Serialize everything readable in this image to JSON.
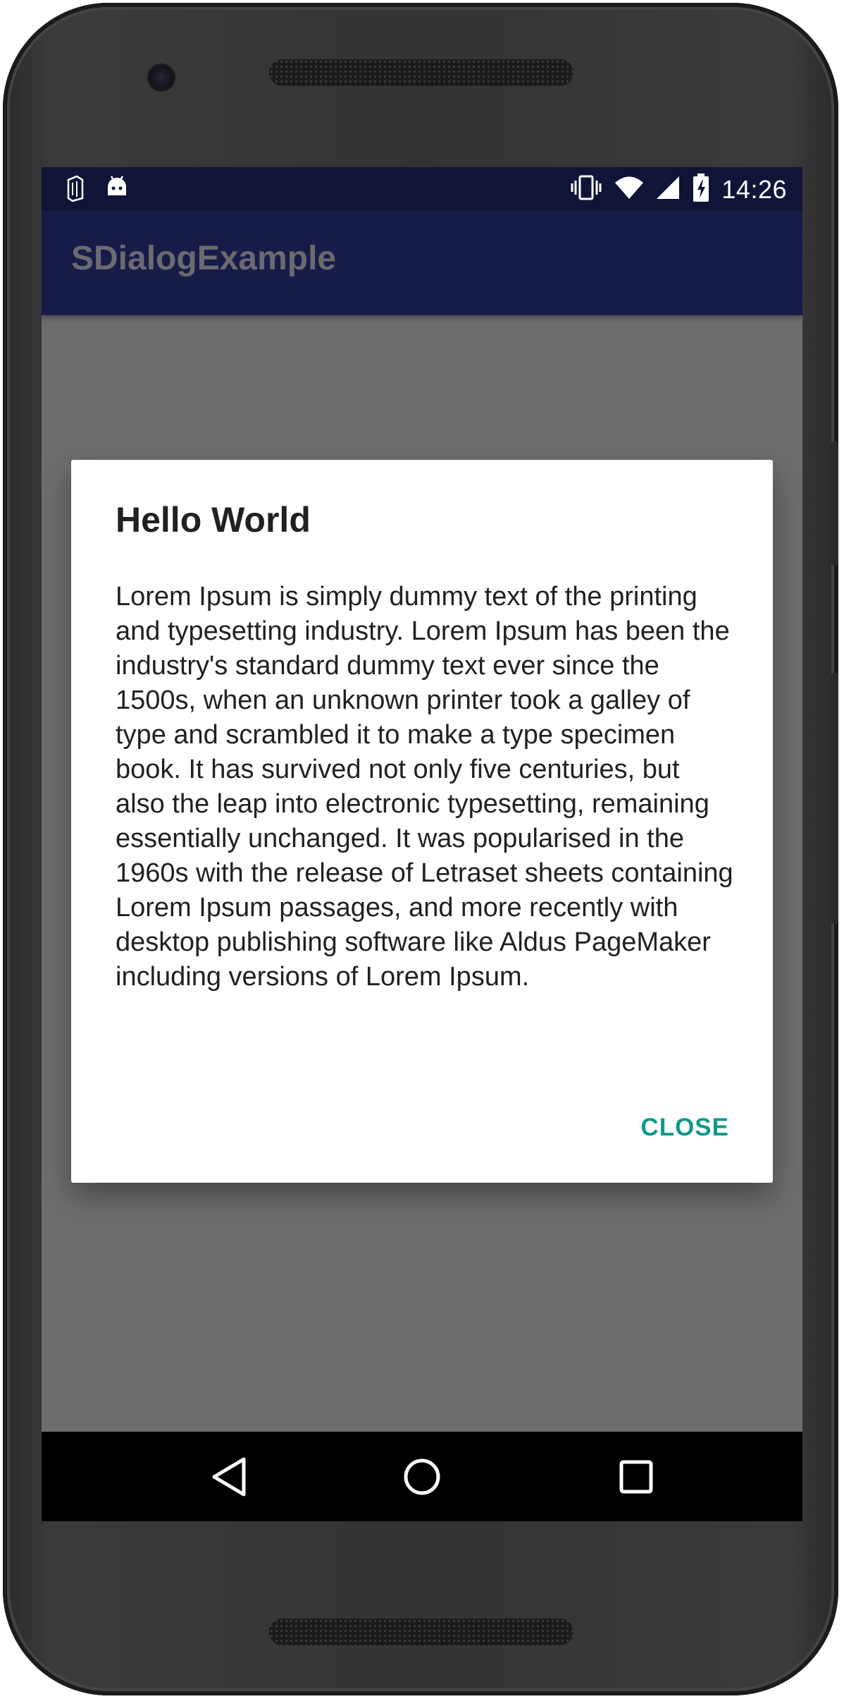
{
  "status_bar": {
    "time": "14:26",
    "left_icons": [
      "sim-card-icon",
      "android-icon"
    ],
    "right_icons": [
      "vibrate-icon",
      "wifi-icon",
      "cell-signal-icon",
      "battery-charging-icon"
    ]
  },
  "app_bar": {
    "title": "SDialogExample"
  },
  "dialog": {
    "title": "Hello World",
    "message": "Lorem Ipsum is simply dummy text of the printing and typesetting industry. Lorem Ipsum has been the industry's standard dummy text ever since the 1500s, when an unknown printer took a galley of type and scrambled it to make a type specimen book. It has survived not only five centuries, but also the leap into electronic typesetting, remaining essentially unchanged. It was popularised in the 1960s with the release of Letraset sheets containing Lorem Ipsum passages, and more recently with desktop publishing software like Aldus PageMaker including versions of Lorem Ipsum.",
    "close_label": "CLOSE"
  },
  "nav_bar": {
    "buttons": [
      "back-icon",
      "home-icon",
      "recents-icon"
    ]
  },
  "colors": {
    "status_bar": "#101436",
    "app_bar": "#161b48",
    "scrim": "#6d6d6d",
    "accent": "#11998a"
  }
}
